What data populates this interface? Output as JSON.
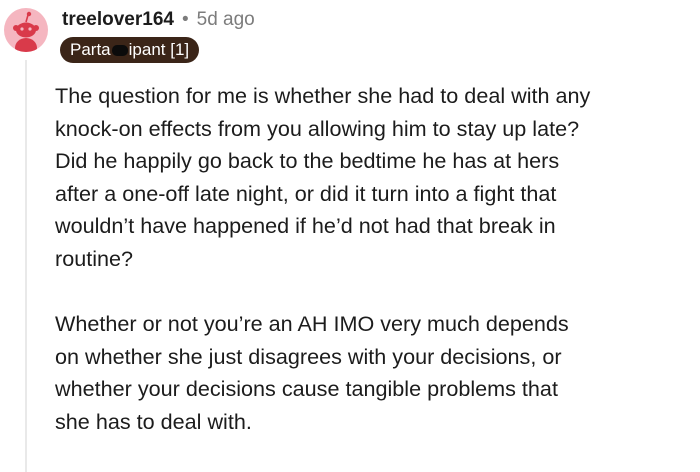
{
  "comment": {
    "username": "treelover164",
    "separator": "•",
    "time_ago": "5d ago",
    "flair": {
      "part1": "Parta",
      "part2": "ipant [1]"
    },
    "paragraphs": [
      "The question for me is whether she had to deal with any\nknock-on effects from you allowing him to stay up late?\nDid he happily go back to the bedtime he has at hers\nafter a one-off late night, or did it turn into a fight that\nwouldn’t have happened if he’d not had that break in\nroutine?",
      "Whether or not you’re an AH IMO very much depends\non whether she just disagrees with your decisions, or\nwhether your decisions cause tangible problems that\nshe has to deal with."
    ]
  },
  "colors": {
    "avatar_bg": "#f5b6c0",
    "avatar_figure": "#d93a4a",
    "flair_bg": "#3b2518",
    "meta_gray": "#7c7c7c",
    "thread_line": "#e9e9e9"
  },
  "icons": {
    "avatar": "reddit-snoo-avatar-icon"
  }
}
